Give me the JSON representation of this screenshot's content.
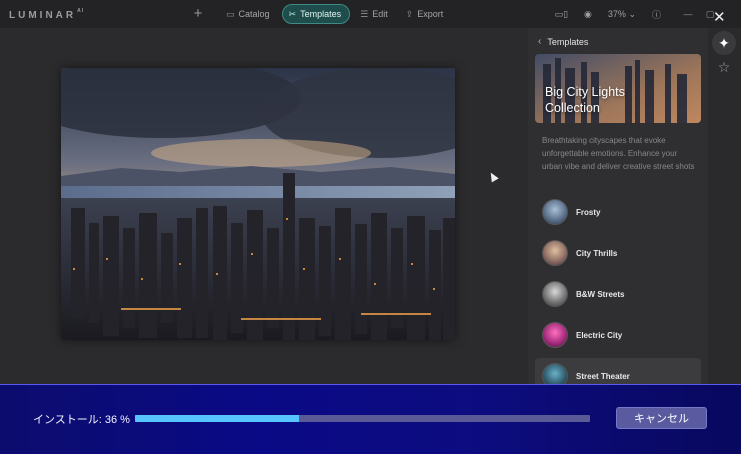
{
  "app": {
    "logo": "LUMINAR",
    "logo_suffix": "AI"
  },
  "nav": {
    "tabs": [
      {
        "label": "Catalog",
        "icon": "folder-icon"
      },
      {
        "label": "Templates",
        "icon": "templates-icon",
        "active": true
      },
      {
        "label": "Edit",
        "icon": "sliders-icon"
      },
      {
        "label": "Export",
        "icon": "export-icon"
      }
    ]
  },
  "toolbar": {
    "zoom": "37%",
    "zoom_caret": "⌄"
  },
  "panel": {
    "back_label": "Templates",
    "collection_title_1": "Big City Lights",
    "collection_title_2": "Collection",
    "description": "Breathtaking cityscapes that evoke unforgettable emotions. Enhance your urban vibe and deliver creative street shots",
    "templates": [
      {
        "label": "Frosty"
      },
      {
        "label": "City Thrills"
      },
      {
        "label": "B&W Streets"
      },
      {
        "label": "Electric City"
      },
      {
        "label": "Street Theater",
        "selected": true
      }
    ]
  },
  "installer": {
    "label": "インストール: 36 %",
    "progress": 0.36,
    "cancel_label": "キャンセル"
  },
  "colors": {
    "accent": "#1f4d4c",
    "progress": "#58c4ff",
    "overlay": "#0a0a86"
  }
}
